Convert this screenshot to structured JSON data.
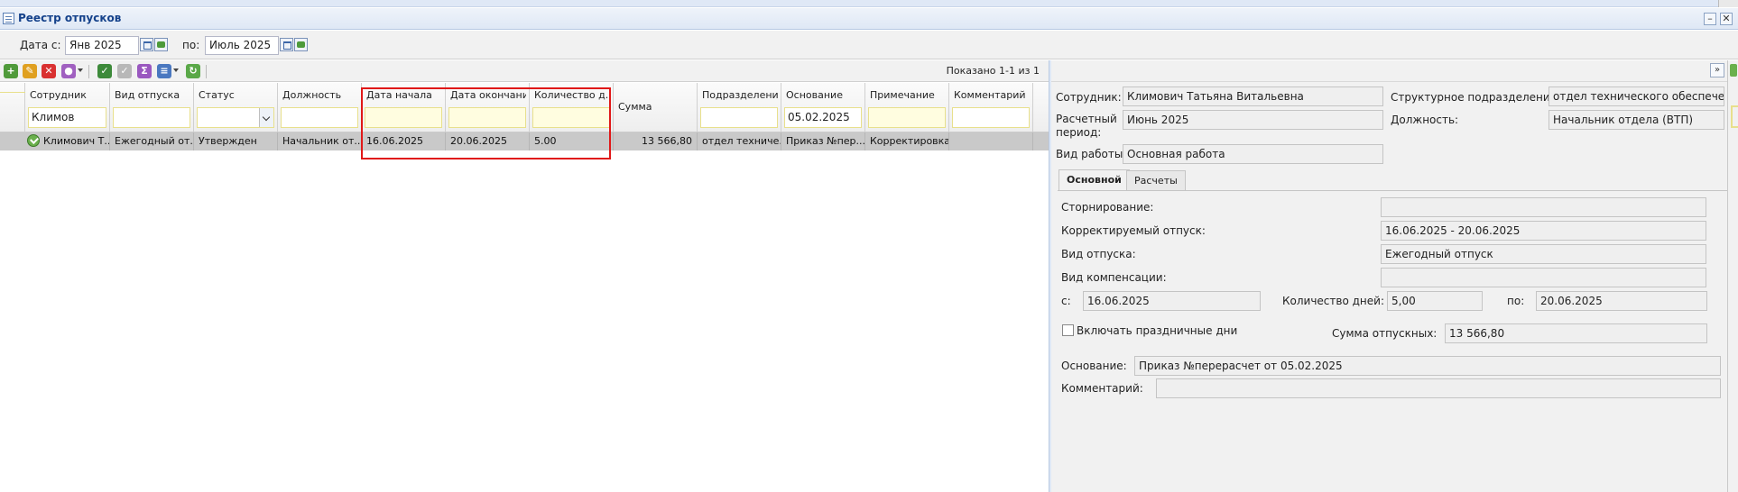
{
  "window": {
    "title": "Реестр отпусков",
    "minimize": "–",
    "close": "✕"
  },
  "date_filter": {
    "from_label": "Дата с:",
    "from_value": "Янв 2025",
    "to_label": "по:",
    "to_value": "Июль 2025"
  },
  "toolbar": {
    "shown_text": "Показано 1-1 из 1"
  },
  "grid": {
    "columns": [
      {
        "label": "Сотрудник",
        "filter": "Климов"
      },
      {
        "label": "Вид отпуска",
        "filter": ""
      },
      {
        "label": "Статус",
        "filter": ""
      },
      {
        "label": "Должность",
        "filter": ""
      },
      {
        "label": "Дата начала",
        "filter": ""
      },
      {
        "label": "Дата окончания",
        "filter": ""
      },
      {
        "label": "Количество д...",
        "filter": ""
      },
      {
        "label": "Сумма",
        "filter": ""
      },
      {
        "label": "Подразделение",
        "filter": ""
      },
      {
        "label": "Основание",
        "filter": "05.02.2025"
      },
      {
        "label": "Примечание",
        "filter": ""
      },
      {
        "label": "Комментарий",
        "filter": ""
      }
    ],
    "rows": [
      {
        "employee": "Климович Т...",
        "leave_type": "Ежегодный от...",
        "status": "Утвержден",
        "position": "Начальник от...",
        "start": "16.06.2025",
        "end": "20.06.2025",
        "days": "5.00",
        "amount": "13 566,80",
        "department": "отдел техниче...",
        "basis": "Приказ №пер...",
        "note": "Корректировка",
        "comment": ""
      }
    ]
  },
  "detail": {
    "collapse": "»",
    "employee_label": "Сотрудник:",
    "employee_value": "Климович Татьяна Витальевна",
    "dept_label": "Структурное подразделение:",
    "dept_value": "отдел технического обеспечения",
    "period_label": "Расчетный период:",
    "period_value": "Июнь 2025",
    "position_label": "Должность:",
    "position_value": "Начальник отдела (ВТП)",
    "worktype_label": "Вид работы:",
    "worktype_value": "Основная работа",
    "tabs": [
      "Основной",
      "Расчеты"
    ],
    "storno_label": "Сторнирование:",
    "storno_value": "",
    "corrected_label": "Корректируемый отпуск:",
    "corrected_value": "16.06.2025 - 20.06.2025",
    "leave_type_label": "Вид отпуска:",
    "leave_type_value": "Ежегодный отпуск",
    "comp_label": "Вид компенсации:",
    "comp_value": "",
    "from_label": "с:",
    "from_value": "16.06.2025",
    "days_label": "Количество дней:",
    "days_value": "5,00",
    "to_label": "по:",
    "to_value": "20.06.2025",
    "holidays_label": "Включать праздничные дни",
    "sum_label": "Сумма отпускных:",
    "sum_value": "13 566,80",
    "basis_label": "Основание:",
    "basis_value": "Приказ №перерасчет от 05.02.2025",
    "comment_label": "Комментарий:",
    "comment_value": ""
  }
}
